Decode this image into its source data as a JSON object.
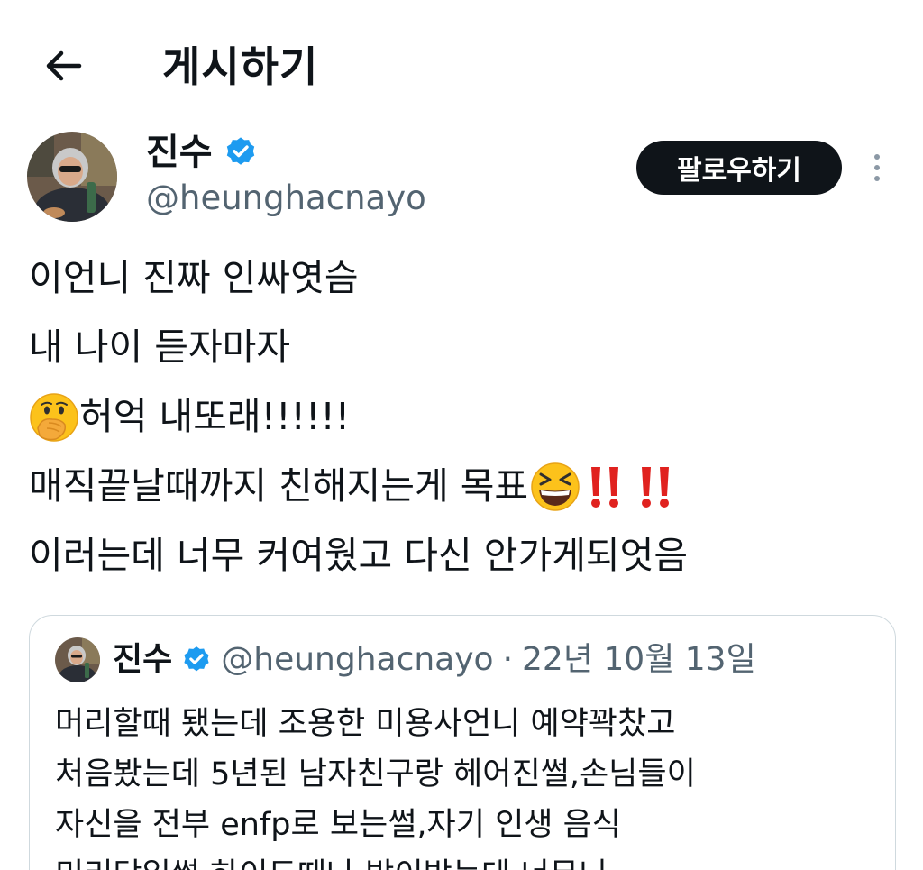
{
  "header": {
    "title": "게시하기",
    "back_icon": "arrow-left-icon"
  },
  "author": {
    "name": "진수",
    "handle": "@heunghacnayo",
    "verified": true,
    "verified_color": "#1d9bf0",
    "follow_label": "팔로우하기"
  },
  "tweet": {
    "line1": "이언니 진짜 인싸엿슴",
    "line2": "내 나이 듣자마자",
    "line3_emoji": "face-with-hand-over-mouth",
    "line3_text": "허억 내또래!!!!!!",
    "line4_text": "매직끝날때까지 친해지는게 목표",
    "line4_emojis": [
      "grinning-squinting-face",
      "double-exclamation",
      "double-exclamation"
    ],
    "line5": "이러는데 너무 커여웠고 다신 안가게되엇음"
  },
  "quote": {
    "name": "진수",
    "handle": "@heunghacnayo",
    "separator": "·",
    "date": "22년 10월 13일",
    "lines": [
      "머리할때 됐는데 조용한 미용사언니 예약꽉찼고",
      "처음봤는데 5년된 남자친구랑 헤어진썰,손님들이",
      "자신을 전부 enfp로 보는썰,자기 인생 음식",
      "미리당일썰 하이도때나 받이받는데 너무니"
    ]
  }
}
